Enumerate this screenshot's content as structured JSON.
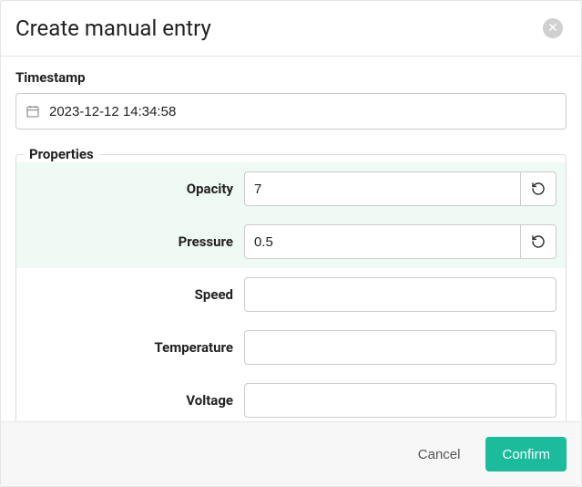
{
  "header": {
    "title": "Create manual entry"
  },
  "timestamp": {
    "label": "Timestamp",
    "value": "2023-12-12 14:34:58"
  },
  "properties": {
    "legend": "Properties",
    "rows": {
      "opacity": {
        "label": "Opacity",
        "value": "7"
      },
      "pressure": {
        "label": "Pressure",
        "value": "0.5"
      },
      "speed": {
        "label": "Speed",
        "value": ""
      },
      "temperature": {
        "label": "Temperature",
        "value": ""
      },
      "voltage": {
        "label": "Voltage",
        "value": ""
      }
    }
  },
  "footer": {
    "cancel": "Cancel",
    "confirm": "Confirm"
  },
  "colors": {
    "accent": "#1abc9c",
    "highlight_bg": "#f0faf4"
  }
}
